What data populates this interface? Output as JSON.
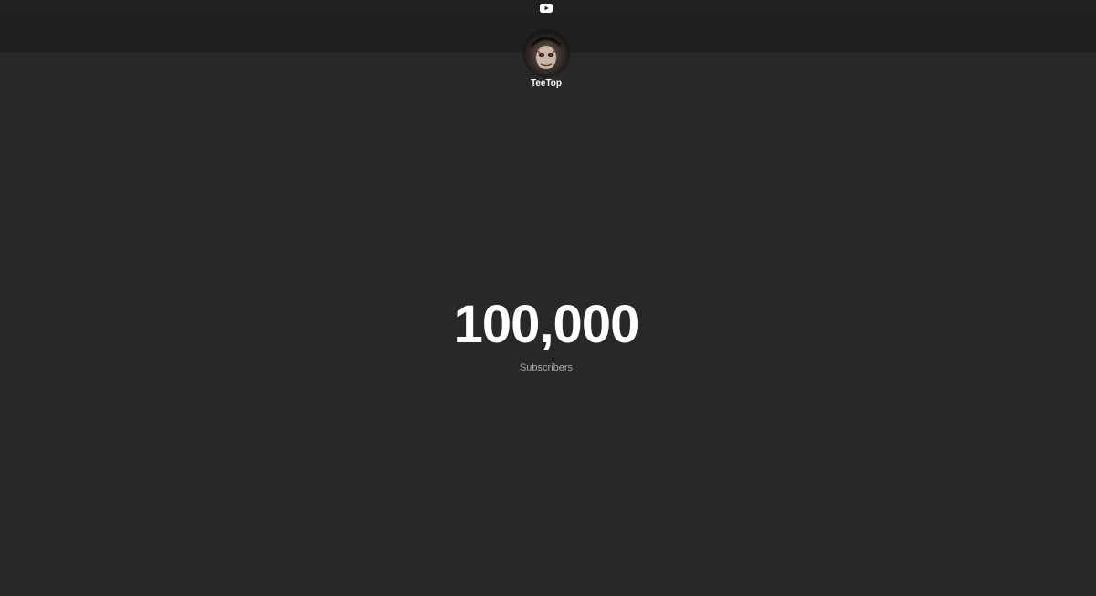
{
  "header": {
    "logo_icon": "youtube-icon"
  },
  "channel": {
    "avatar_icon": "channel-avatar",
    "name": "TeeTop"
  },
  "stats": {
    "count": "100,000",
    "label": "Subscribers"
  },
  "colors": {
    "background": "#282828",
    "header": "#212121",
    "text": "#ffffff",
    "label": "#aaaaaa"
  }
}
